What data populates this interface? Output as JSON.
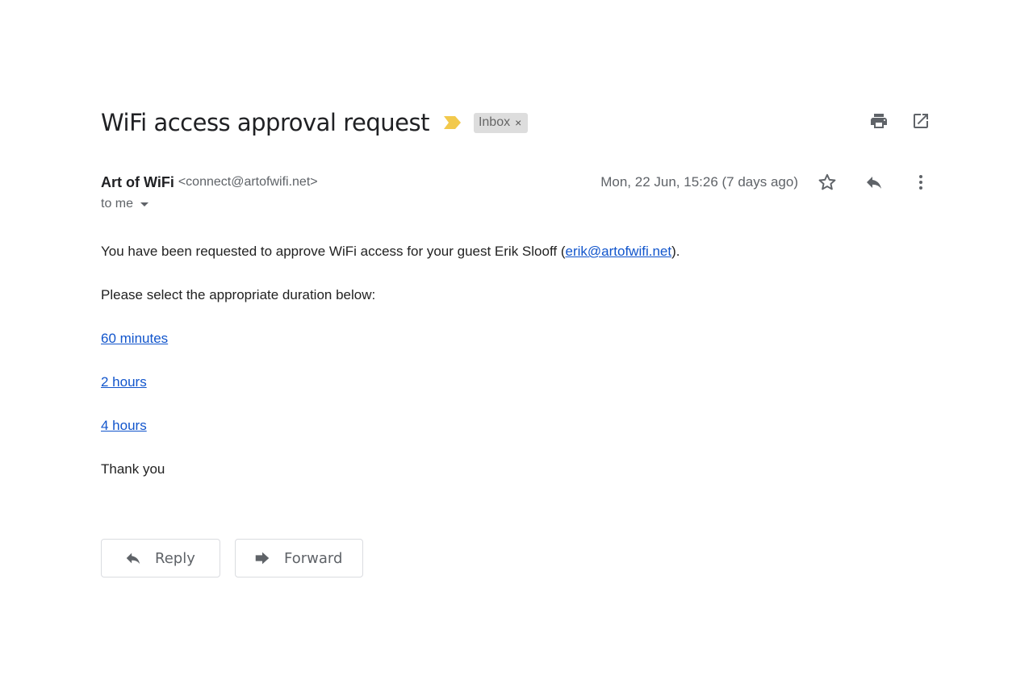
{
  "email": {
    "subject": "WiFi access approval request",
    "label": "Inbox",
    "label_remove": "×",
    "sender_name": "Art of WiFi",
    "sender_email": "<connect@artofwifi.net>",
    "date": "Mon, 22 Jun, 15:26 (7 days ago)",
    "recipient": "to me"
  },
  "body": {
    "intro_prefix": "You have been requested to approve WiFi access for your guest Erik Slooff (",
    "guest_email_link": "erik@artofwifi.net",
    "intro_suffix": ").",
    "instruction": "Please select the appropriate duration below:",
    "options": [
      "60 minutes",
      "2 hours",
      "4 hours"
    ],
    "closing": "Thank you"
  },
  "actions": {
    "reply_label": "Reply",
    "forward_label": "Forward"
  },
  "icons": {
    "importance": "importance-marker-icon",
    "print": "print-icon",
    "open_new_window": "open-in-new-icon",
    "star": "star-icon",
    "reply": "reply-icon",
    "more": "more-vert-icon",
    "forward": "forward-icon"
  },
  "colors": {
    "importance_marker": "#f2c94c",
    "link": "#1155cc",
    "label_chip_bg": "#dddddd"
  }
}
